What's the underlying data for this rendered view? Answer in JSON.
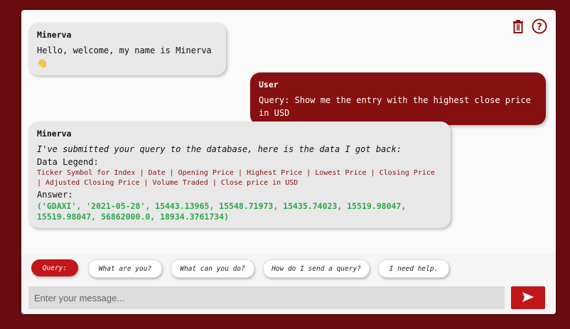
{
  "header": {
    "trash_icon": "trash-icon",
    "help_icon": "help-circle-icon"
  },
  "messages": [
    {
      "sender": "Minerva",
      "text": "Hello, welcome, my name is Minerva",
      "emoji": "👋"
    },
    {
      "sender": "User",
      "text": "Query: Show me the entry with the highest close price in USD"
    },
    {
      "sender": "Minerva",
      "intro": "I've submitted your query to the database, here is the data I got back:",
      "legend_label": "Data Legend:",
      "legend_items": "Ticker Symbol for Index | Date | Opening Price | Highest Price | Lowest Price | Closing Price | Adjusted Closing Price | Volume Traded | Close price in USD",
      "answer_label": "Answer:",
      "answer_value": "('GDAXI', '2021-05-28', 15443.13965, 15548.71973, 15435.74023, 15519.98047, 15519.98047, 56862000.0, 18934.3761734)"
    }
  ],
  "quick_replies": [
    "Query:",
    "What are you?",
    "What can you do?",
    "How do I send a query?",
    "I need help."
  ],
  "input": {
    "placeholder": "Enter your message..."
  },
  "colors": {
    "accent": "#c0171a",
    "user_bubble": "#871011",
    "answer_green": "#2ca84a"
  }
}
